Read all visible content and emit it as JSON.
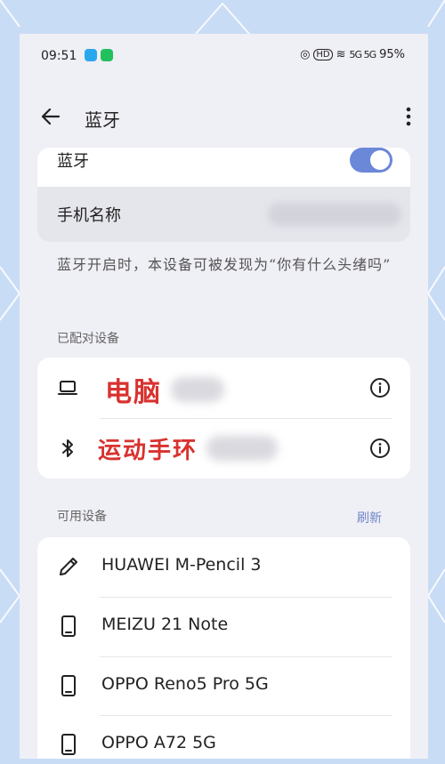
{
  "status_bar": {
    "time": "09:51",
    "signal_text": "5G 5G",
    "battery": "95%"
  },
  "header": {
    "title": "蓝牙",
    "back_icon": "arrow-left-icon",
    "more_icon": "more-vertical-icon"
  },
  "bluetooth": {
    "label": "蓝牙",
    "enabled": true,
    "device_name_label": "手机名称"
  },
  "description": "蓝牙开启时，本设备可被发现为“你有什么头绪吗”",
  "paired": {
    "title": "已配对设备",
    "devices": [
      {
        "name": "电脑",
        "icon": "laptop-icon"
      },
      {
        "name": "运动手环",
        "icon": "bluetooth-icon"
      }
    ]
  },
  "available": {
    "title": "可用设备",
    "refresh": "刷新",
    "devices": [
      {
        "name": "HUAWEI M-Pencil 3",
        "icon": "pencil-icon"
      },
      {
        "name": "MEIZU 21 Note",
        "icon": "phone-icon"
      },
      {
        "name": "OPPO Reno5 Pro 5G",
        "icon": "phone-icon"
      },
      {
        "name": "OPPO A72 5G",
        "icon": "phone-icon"
      }
    ]
  },
  "colors": {
    "accent": "#6b87d8",
    "background": "#efeff6",
    "paired_name_ink": "#d8322f"
  }
}
